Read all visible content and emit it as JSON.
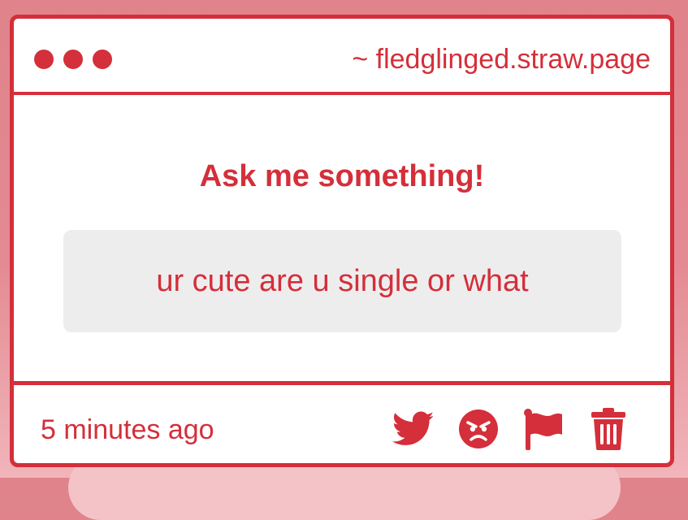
{
  "window": {
    "url": "~ fledglinged.straw.page"
  },
  "main": {
    "title": "Ask me something!",
    "question": "ur cute are u single or what"
  },
  "footer": {
    "timestamp": "5 minutes ago",
    "actions": [
      {
        "icon": "twitter-icon"
      },
      {
        "icon": "angry-face-icon"
      },
      {
        "icon": "flag-icon"
      },
      {
        "icon": "trash-icon"
      }
    ]
  },
  "colors": {
    "accent": "#d42f3a",
    "question_background": "#eeedee",
    "page_background": "#e0838b"
  }
}
